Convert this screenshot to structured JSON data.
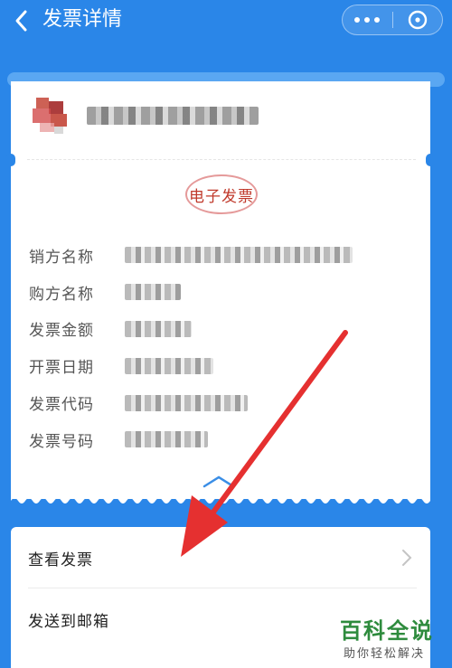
{
  "header": {
    "title": "发票详情",
    "back_icon": "chevron-left-icon",
    "more_icon": "more-dots-icon",
    "close_icon": "close-circle-icon"
  },
  "invoice": {
    "stamp_text": "电子发票",
    "fields": [
      {
        "label": "销方名称"
      },
      {
        "label": "购方名称"
      },
      {
        "label": "发票金额"
      },
      {
        "label": "开票日期"
      },
      {
        "label": "发票代码"
      },
      {
        "label": "发票号码"
      }
    ]
  },
  "actions": {
    "view_invoice": "查看发票",
    "send_email": "发送到邮箱"
  },
  "watermark": {
    "main": "百科全说",
    "sub": "助你轻松解决"
  },
  "colors": {
    "background": "#2a86e8",
    "stamp": "#c0392b",
    "annotation_arrow": "#e53030",
    "watermark": "#2e8b3d"
  }
}
